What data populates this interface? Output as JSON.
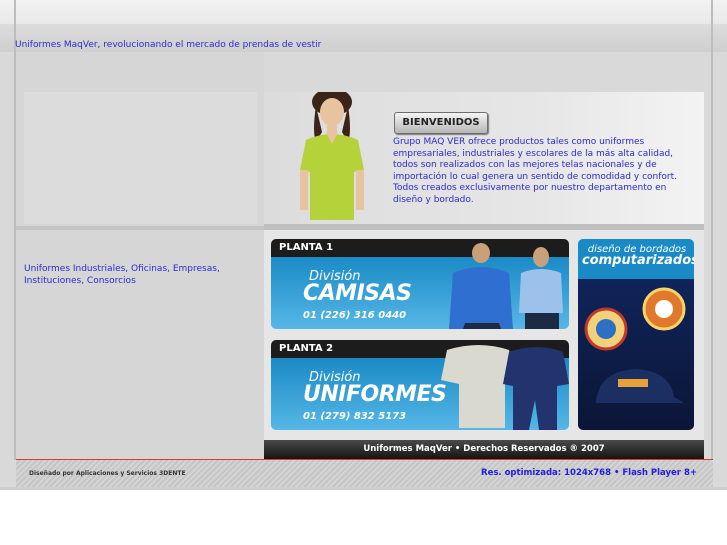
{
  "header": {
    "tagline": "Uniformes MaqVer, revolucionando el mercado de prendas de vestir"
  },
  "sidebar": {
    "info": "Uniformes Industriales, Oficinas, Empresas, Instituciones, Consorcios"
  },
  "welcome": {
    "button_label": "BIENVENIDOS",
    "text": "Grupo MAQ VER ofrece productos tales como uniformes empresariales, industriales y escolares de la más alta calidad, todos son realizados con las mejores telas nacionales y de importación lo cual genera un sentido de comodidad y confort. Todos creados exclusivamente por nuestro departamento en diseño y bordado."
  },
  "banners": [
    {
      "plant": "PLANTA 1",
      "division": "División",
      "name": "CAMISAS",
      "phone": "01 (226) 316 0440"
    },
    {
      "plant": "PLANTA 2",
      "division": "División",
      "name": "UNIFORMES",
      "phone": "01 (279) 832 5173"
    }
  ],
  "bordados": {
    "line1": "diseño de bordados",
    "line2": "computarizados"
  },
  "footer": {
    "copyright": "Uniformes MaqVer • Derechos Reservados ® 2007",
    "credit": "Diseñado por Aplicaciones y Servicios 3DENTE",
    "optimization": "Res. optimizada: 1024x768 • Flash Player 8+"
  }
}
